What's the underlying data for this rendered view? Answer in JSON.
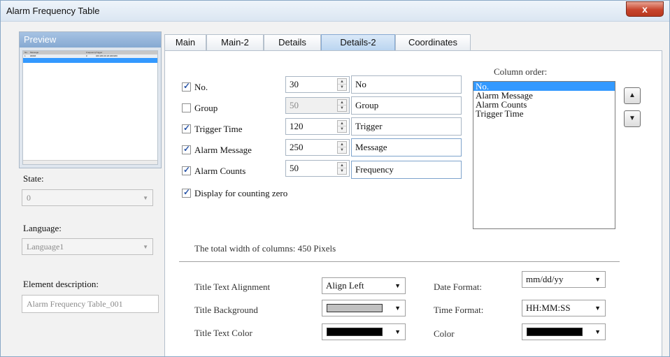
{
  "window": {
    "title": "Alarm Frequency Table",
    "close_label": "x"
  },
  "preview": {
    "header": "Preview",
    "mini_cols": [
      "No.",
      "Message",
      "Frequency",
      "Trigger"
    ],
    "mini_row": [
      "1",
      "#####",
      "#",
      "###.###.##.##.###/###"
    ]
  },
  "state": {
    "label": "State:",
    "value": "0"
  },
  "language": {
    "label": "Language:",
    "value": "Language1"
  },
  "element_description": {
    "label": "Element description:",
    "value": "Alarm Frequency Table_001"
  },
  "tabs": [
    {
      "label": "Main"
    },
    {
      "label": "Main-2"
    },
    {
      "label": "Details"
    },
    {
      "label": "Details-2"
    },
    {
      "label": "Coordinates"
    }
  ],
  "columns": [
    {
      "label": "No.",
      "checked": true,
      "width": "30",
      "title": "No"
    },
    {
      "label": "Group",
      "checked": false,
      "width": "50",
      "title": "Group"
    },
    {
      "label": "Trigger Time",
      "checked": true,
      "width": "120",
      "title": "Trigger"
    },
    {
      "label": "Alarm Message",
      "checked": true,
      "width": "250",
      "title": "Message"
    },
    {
      "label": "Alarm Counts",
      "checked": true,
      "width": "50",
      "title": "Frequency"
    }
  ],
  "display_zero": {
    "label": "Display for counting zero",
    "checked": true
  },
  "column_order": {
    "label": "Column order:",
    "items": [
      "No.",
      "Alarm Message",
      "Alarm Counts",
      "Trigger Time"
    ]
  },
  "total_width": "The total width of columns: 450 Pixels",
  "props": {
    "title_text_alignment": {
      "label": "Title Text Alignment",
      "value": "Align Left"
    },
    "title_background": {
      "label": "Title Background",
      "color": "#c0c0c0"
    },
    "title_text_color": {
      "label": "Title Text Color",
      "color": "#000000"
    },
    "date_format": {
      "label": "Date Format:",
      "value": "mm/dd/yy"
    },
    "time_format": {
      "label": "Time Format:",
      "value": "HH:MM:SS"
    },
    "color": {
      "label": "Color",
      "color": "#000000"
    }
  },
  "colors": {
    "accent": "#3399ff",
    "tab_active": "#b9d4f0",
    "close": "#c7452d"
  }
}
